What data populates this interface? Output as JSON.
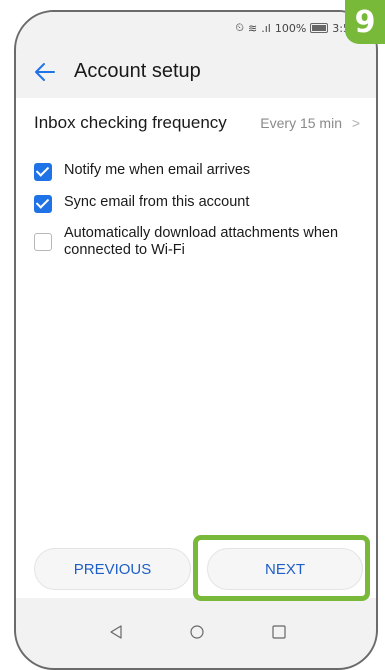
{
  "status_bar": {
    "battery": "100%",
    "time": "3:5"
  },
  "step_badge": "9",
  "app_bar": {
    "title": "Account setup"
  },
  "inbox_frequency": {
    "label": "Inbox checking frequency",
    "value": "Every 15 min"
  },
  "options": [
    {
      "label": "Notify me when email arrives",
      "checked": true
    },
    {
      "label": "Sync email from this account",
      "checked": true
    },
    {
      "label": "Automatically download attachments when connected to Wi-Fi",
      "checked": false
    }
  ],
  "buttons": {
    "previous": "PREVIOUS",
    "next": "NEXT"
  },
  "colors": {
    "accent": "#1f73e6",
    "button_text": "#1f5fc7",
    "highlight": "#79b939"
  },
  "icons": [
    "back-arrow-icon",
    "nav-back-icon",
    "nav-home-icon",
    "nav-recent-icon",
    "alarm-icon",
    "wifi-icon",
    "signal-icon",
    "battery-icon"
  ]
}
